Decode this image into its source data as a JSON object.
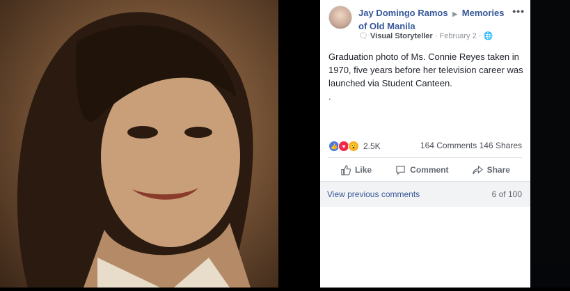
{
  "post": {
    "author": "Jay Domingo Ramos",
    "group": "Memories of Old Manila",
    "badge": "Visual Storyteller",
    "date": "February 2",
    "more": "•••",
    "text": "Graduation photo of Ms. Connie Reyes taken in 1970, five years before her television career was launched via Student Canteen.",
    "dot": "."
  },
  "stats": {
    "reactions": "2.5K",
    "comments": "164 Comments",
    "shares": "146 Shares"
  },
  "actions": {
    "like": "Like",
    "comment": "Comment",
    "share": "Share"
  },
  "comments": {
    "view_previous": "View previous comments",
    "count": "6 of 100"
  },
  "colors": {
    "link": "#365899",
    "like_blue": "#4a7be0",
    "love_red": "#f0284a",
    "wow_yellow": "#f7b125"
  }
}
